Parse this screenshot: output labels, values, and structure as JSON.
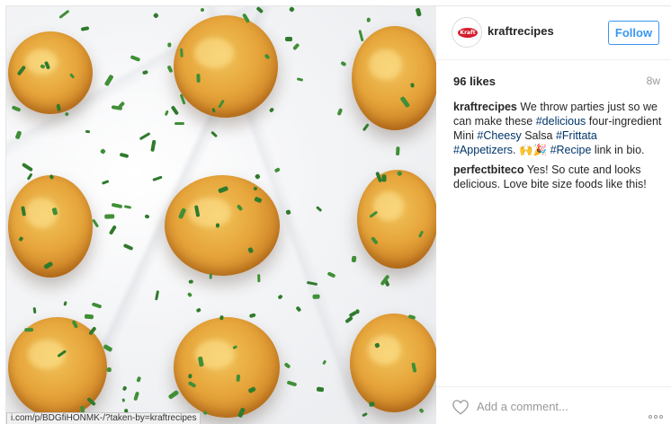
{
  "photo": {
    "alt_subject": "mini-frittata-photo",
    "status_url": "i.com/p/BDGfiHONMK-/?taken-by=kraftrecipes"
  },
  "header": {
    "username": "kraftrecipes",
    "avatar_logo_text": "Kraft",
    "follow_label": "Follow"
  },
  "stats": {
    "likes": "96 likes",
    "age": "8w"
  },
  "comments": [
    {
      "author": "kraftrecipes",
      "parts": [
        {
          "t": "text",
          "v": " We throw parties just so we can make these "
        },
        {
          "t": "tag",
          "v": "#delicious"
        },
        {
          "t": "text",
          "v": " four-ingredient Mini "
        },
        {
          "t": "tag",
          "v": "#Cheesy"
        },
        {
          "t": "text",
          "v": " Salsa "
        },
        {
          "t": "tag",
          "v": "#Frittata"
        },
        {
          "t": "text",
          "v": " "
        },
        {
          "t": "tag",
          "v": "#Appetizers"
        },
        {
          "t": "text",
          "v": ". 🙌🎉 "
        },
        {
          "t": "tag",
          "v": "#Recipe"
        },
        {
          "t": "text",
          "v": " link in bio."
        }
      ]
    },
    {
      "author": "perfectbiteco",
      "parts": [
        {
          "t": "text",
          "v": " Yes! So cute and looks delicious. Love bite size foods like this!"
        }
      ]
    }
  ],
  "footer": {
    "comment_placeholder": "Add a comment...",
    "heart_icon": "heart-outline-icon",
    "more_icon": "more-options-icon"
  },
  "colors": {
    "link": "#003569",
    "follow": "#3897f0",
    "brand": "#d51e2d"
  }
}
